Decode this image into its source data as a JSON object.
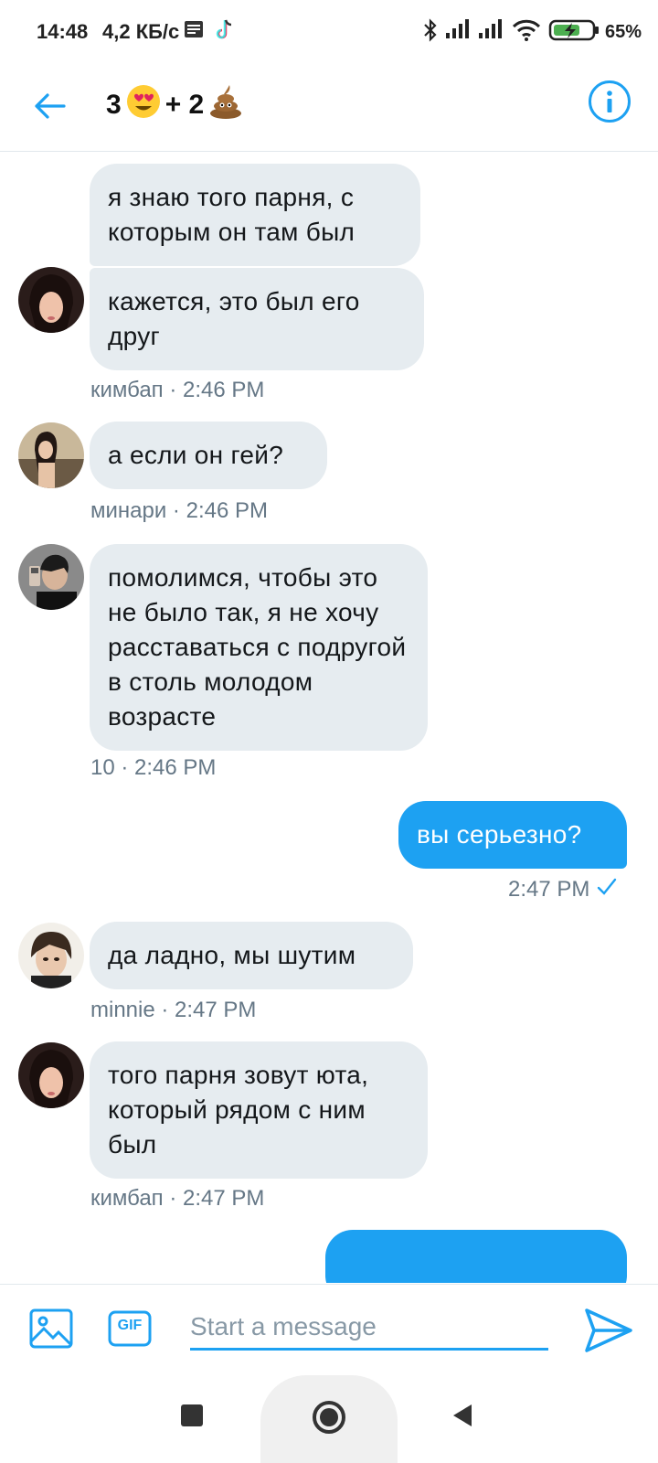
{
  "status_bar": {
    "time": "14:48",
    "speed": "4,2 КБ/с",
    "battery": "65%"
  },
  "header": {
    "title_count_1": "3",
    "title_plus": "+ 2",
    "icons": [
      "heart-eyes-emoji",
      "poop-emoji"
    ]
  },
  "messages": [
    {
      "id": "m1",
      "text": "я знаю того парня, с которым он там был",
      "mine": false
    },
    {
      "id": "m2",
      "text": "кажется, это был его друг",
      "mine": false,
      "meta": "кимбап · 2:46 PM"
    },
    {
      "id": "m3",
      "text": "а если он гей?",
      "mine": false,
      "meta": "минари · 2:46 PM"
    },
    {
      "id": "m4",
      "text": "помолимся, чтобы это не было так, я не хочу расставаться с подругой в столь молодом возрасте",
      "mine": false,
      "meta": "10 · 2:46 PM"
    },
    {
      "id": "m5",
      "text": "вы серьезно?",
      "mine": true,
      "meta": "2:47 PM"
    },
    {
      "id": "m6",
      "text": "да ладно, мы шутим",
      "mine": false,
      "meta": "minnie · 2:47 PM"
    },
    {
      "id": "m7",
      "text": "того парня зовут юта, который рядом с ним был",
      "mine": false,
      "meta": "кимбап · 2:47 PM"
    }
  ],
  "composer": {
    "placeholder": "Start a message",
    "gif_label": "GIF"
  },
  "colors": {
    "accent": "#1da1f2",
    "bubble_other": "#e6ecf0",
    "meta_text": "#657786"
  }
}
